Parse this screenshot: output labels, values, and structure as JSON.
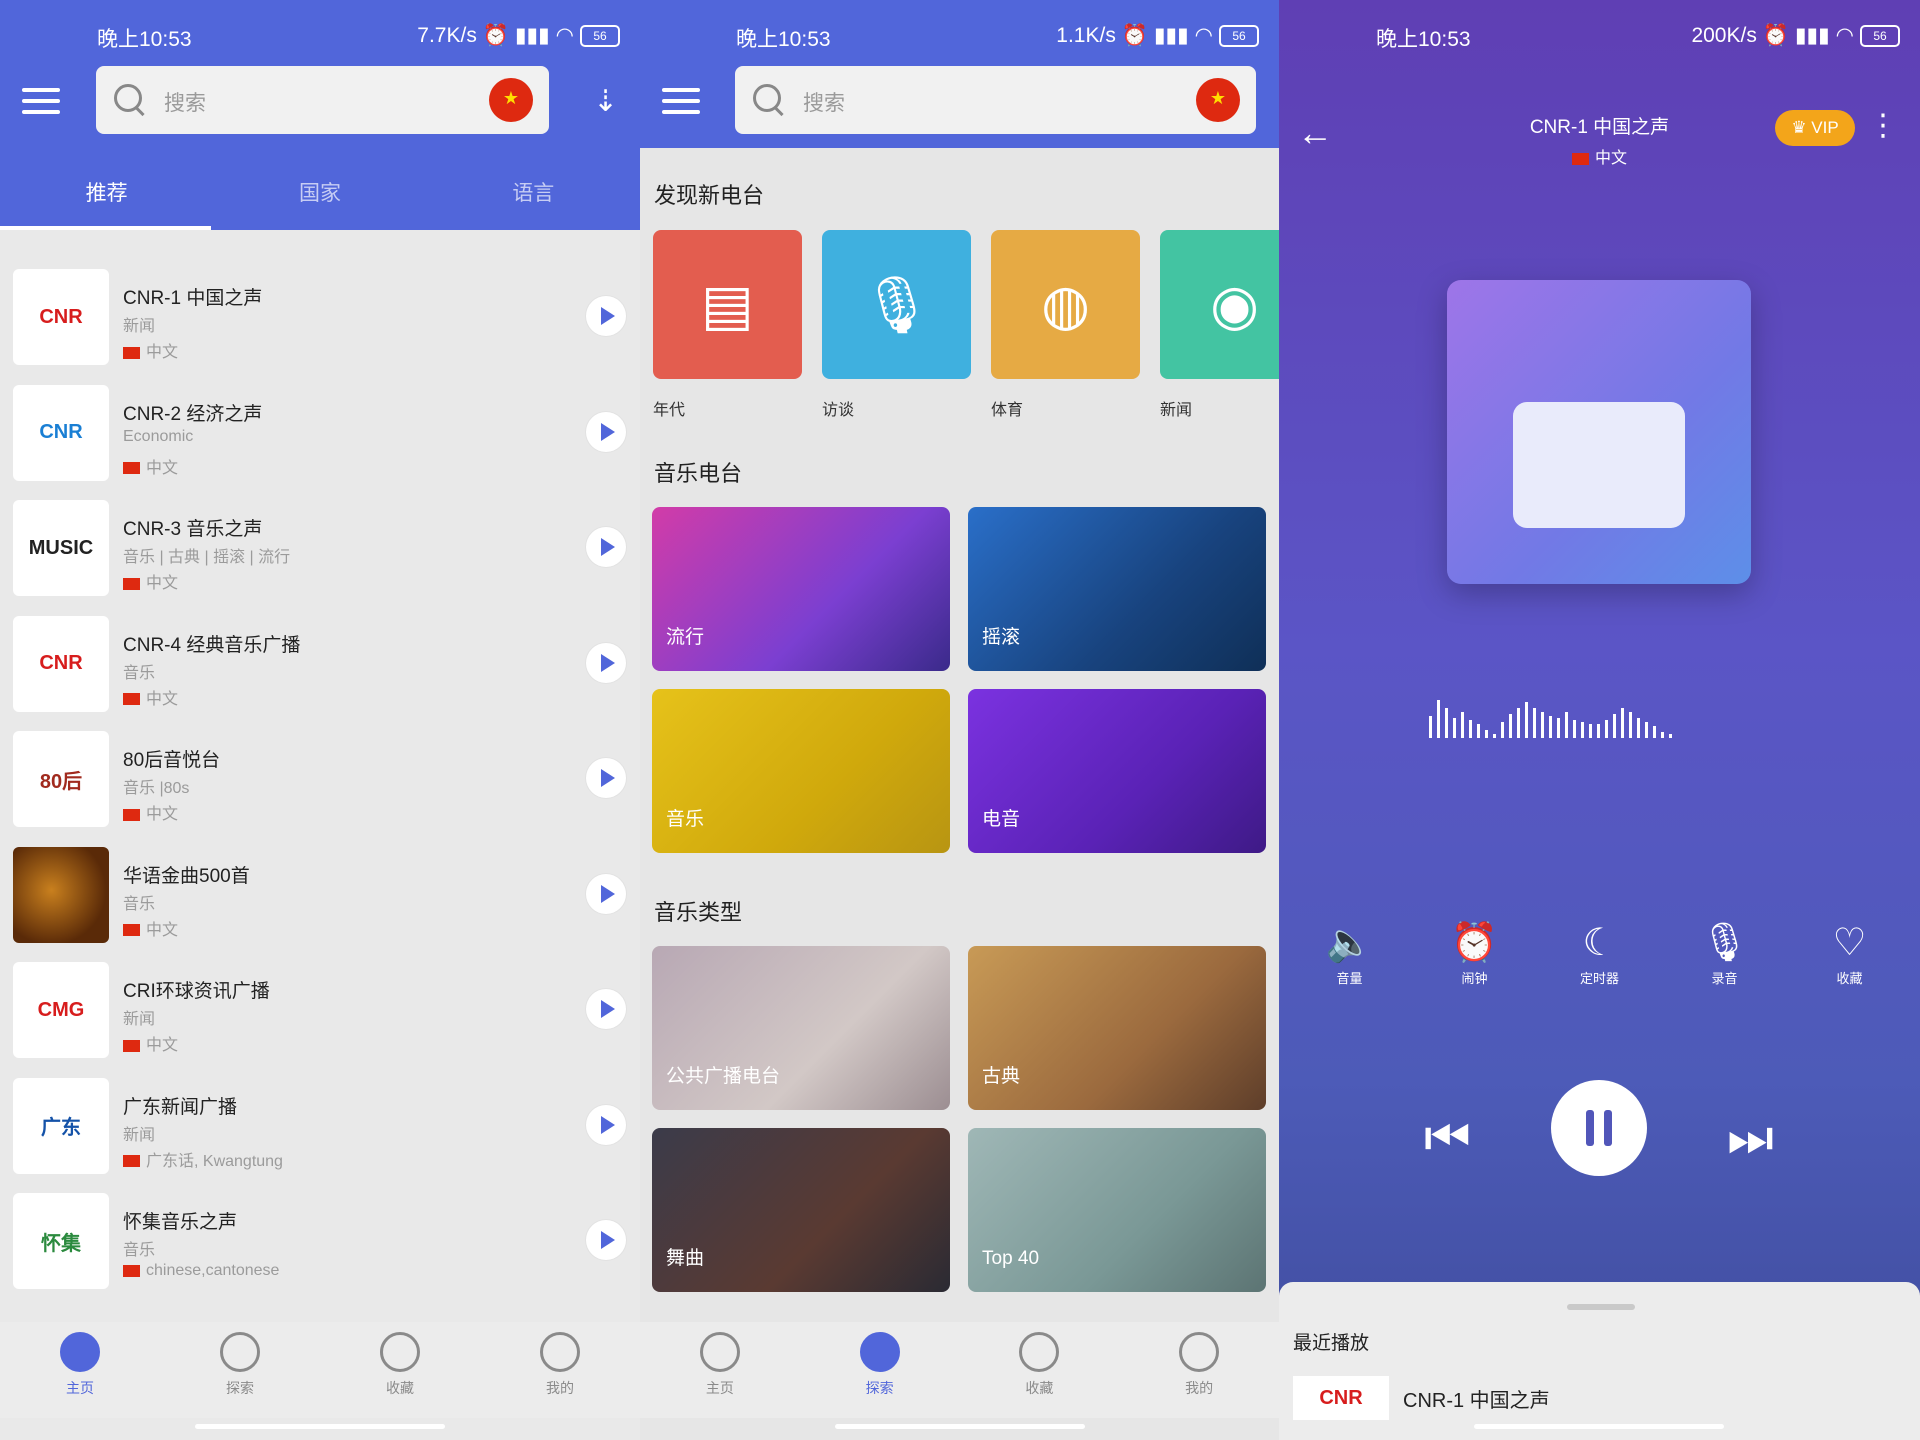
{
  "status_bars": [
    {
      "time": "晚上10:53",
      "speed": "7.7K/s",
      "battery": "56"
    },
    {
      "time": "晚上10:53",
      "speed": "1.1K/s",
      "battery": "56"
    },
    {
      "time": "晚上10:53",
      "speed": "200K/s",
      "battery": "56"
    }
  ],
  "home": {
    "search_placeholder": "搜索",
    "tabs": [
      "推荐",
      "国家",
      "语言"
    ],
    "stations": [
      {
        "title": "CNR-1 中国之声",
        "genre": "新闻",
        "lang": "中文",
        "thumb": "CNR",
        "thumb_color": "#d71d1d"
      },
      {
        "title": "CNR-2 经济之声",
        "genre": "Economic",
        "lang": "中文",
        "thumb": "CNR",
        "thumb_color": "#1a7fd4"
      },
      {
        "title": "CNR-3 音乐之声",
        "genre": "音乐 | 古典 | 摇滚 | 流行",
        "lang": "中文",
        "thumb": "MUSIC",
        "thumb_color": "#222222"
      },
      {
        "title": "CNR-4 经典音乐广播",
        "genre": "音乐",
        "lang": "中文",
        "thumb": "CNR",
        "thumb_color": "#d71d1d"
      },
      {
        "title": "80后音悦台",
        "genre": "音乐 |80s",
        "lang": "中文",
        "thumb": "80后",
        "thumb_color": "#a12a1e"
      },
      {
        "title": "华语金曲500首",
        "genre": "音乐",
        "lang": "中文",
        "thumb": "",
        "thumb_color": "#7a3a10"
      },
      {
        "title": "CRI环球资讯广播",
        "genre": "新闻",
        "lang": "中文",
        "thumb": "CMG",
        "thumb_color": "#d71d1d"
      },
      {
        "title": "广东新闻广播",
        "genre": "新闻",
        "lang": "广东话, Kwangtung",
        "thumb": "广东",
        "thumb_color": "#1452a8"
      },
      {
        "title": "怀集音乐之声",
        "genre": "音乐",
        "lang": "chinese,cantonese",
        "thumb": "怀集",
        "thumb_color": "#2b8a3e"
      }
    ]
  },
  "explore": {
    "search_placeholder": "搜索",
    "discover_title": "发现新电台",
    "categories": [
      {
        "label": "年代",
        "icon": "calendar-icon",
        "color": "#e35d4f",
        "glyph": "▤"
      },
      {
        "label": "访谈",
        "icon": "microphone-icon",
        "color": "#3fb0df",
        "glyph": "🎙"
      },
      {
        "label": "体育",
        "icon": "basketball-icon",
        "color": "#e6aa44",
        "glyph": "◍"
      },
      {
        "label": "新闻",
        "icon": "broadcast-icon",
        "color": "#43c4a2",
        "glyph": "◉"
      }
    ],
    "music_stations_title": "音乐电台",
    "music_stations": [
      {
        "label": "流行",
        "bg": "linear-gradient(135deg,#d23ca8,#7b3fd1 60%,#3a2a8a)"
      },
      {
        "label": "摇滚",
        "bg": "linear-gradient(135deg,#2a6fc9,#18437e 60%,#0f2f57)"
      },
      {
        "label": "音乐",
        "bg": "linear-gradient(135deg,#e6c21a,#d0a90c 60%,#b89512)"
      },
      {
        "label": "电音",
        "bg": "linear-gradient(135deg,#7b32e0,#5a22b6 60%,#3e1a86)"
      }
    ],
    "music_types_title": "音乐类型",
    "music_types": [
      {
        "label": "公共广播电台",
        "bg": "linear-gradient(135deg,#b8a8b4,#d2c8c6 60%,#9c8e92)"
      },
      {
        "label": "古典",
        "bg": "linear-gradient(135deg,#c89a56,#9b6a3e 60%,#5e3e2a)"
      },
      {
        "label": "舞曲",
        "bg": "linear-gradient(135deg,#3b3b4a,#5a3a32 60%,#2a2a33)"
      },
      {
        "label": "Top 40",
        "bg": "linear-gradient(135deg,#9fb7b6,#7a9896 60%,#5c7473)"
      }
    ]
  },
  "nav": {
    "items": [
      {
        "label": "主页",
        "icon": "home-icon"
      },
      {
        "label": "探索",
        "icon": "compass-icon"
      },
      {
        "label": "收藏",
        "icon": "heart-icon"
      },
      {
        "label": "我的",
        "icon": "profile-icon"
      }
    ],
    "accent": "#5166da"
  },
  "player": {
    "title": "CNR-1 中国之声",
    "subtitle": "中文",
    "vip_label": "VIP",
    "controls": [
      {
        "label": "音量",
        "icon": "volume-icon",
        "glyph": "🔈"
      },
      {
        "label": "闹钟",
        "icon": "alarm-icon",
        "glyph": "⏰"
      },
      {
        "label": "定时器",
        "icon": "sleep-timer-icon",
        "glyph": "☾"
      },
      {
        "label": "录音",
        "icon": "record-icon",
        "glyph": "🎙"
      },
      {
        "label": "收藏",
        "icon": "heart-icon",
        "glyph": "♡"
      }
    ],
    "recent_title": "最近播放",
    "recent": [
      {
        "title": "CNR-1 中国之声",
        "thumb": "CNR"
      }
    ]
  }
}
